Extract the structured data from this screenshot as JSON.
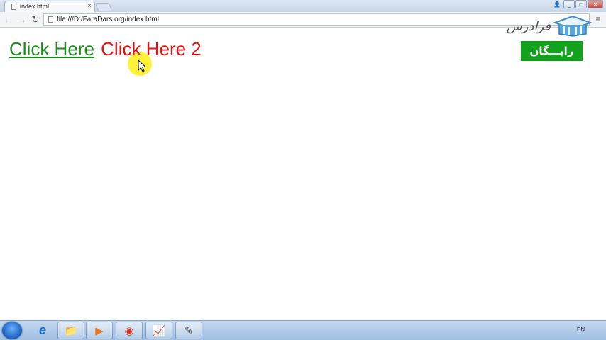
{
  "browser": {
    "tab_title": "index.html",
    "tab_close": "×",
    "address": "file:///D:/FaraDars.org/index.html",
    "back": "←",
    "forward": "→",
    "reload": "↻",
    "menu": "≡",
    "window_buttons": {
      "user": "👤",
      "minimize": "_",
      "maximize": "□",
      "close": "✕"
    }
  },
  "page": {
    "link1": "Click Here",
    "link2": "Click Here 2"
  },
  "watermark": {
    "logo_text": "فرادرس",
    "badge": "رایـــگان"
  },
  "taskbar": {
    "language": "EN",
    "buttons": [
      {
        "name": "internet-explorer",
        "glyph": "e"
      },
      {
        "name": "file-explorer",
        "glyph": "📁"
      },
      {
        "name": "media-player",
        "glyph": "▶"
      },
      {
        "name": "chrome",
        "glyph": "◉"
      },
      {
        "name": "chart-app",
        "glyph": "📈"
      },
      {
        "name": "tool-app",
        "glyph": "✎"
      }
    ]
  },
  "colors": {
    "link_visited": "#1e8a1e",
    "link_hover": "#e41313",
    "badge_bg": "#14a21e"
  }
}
